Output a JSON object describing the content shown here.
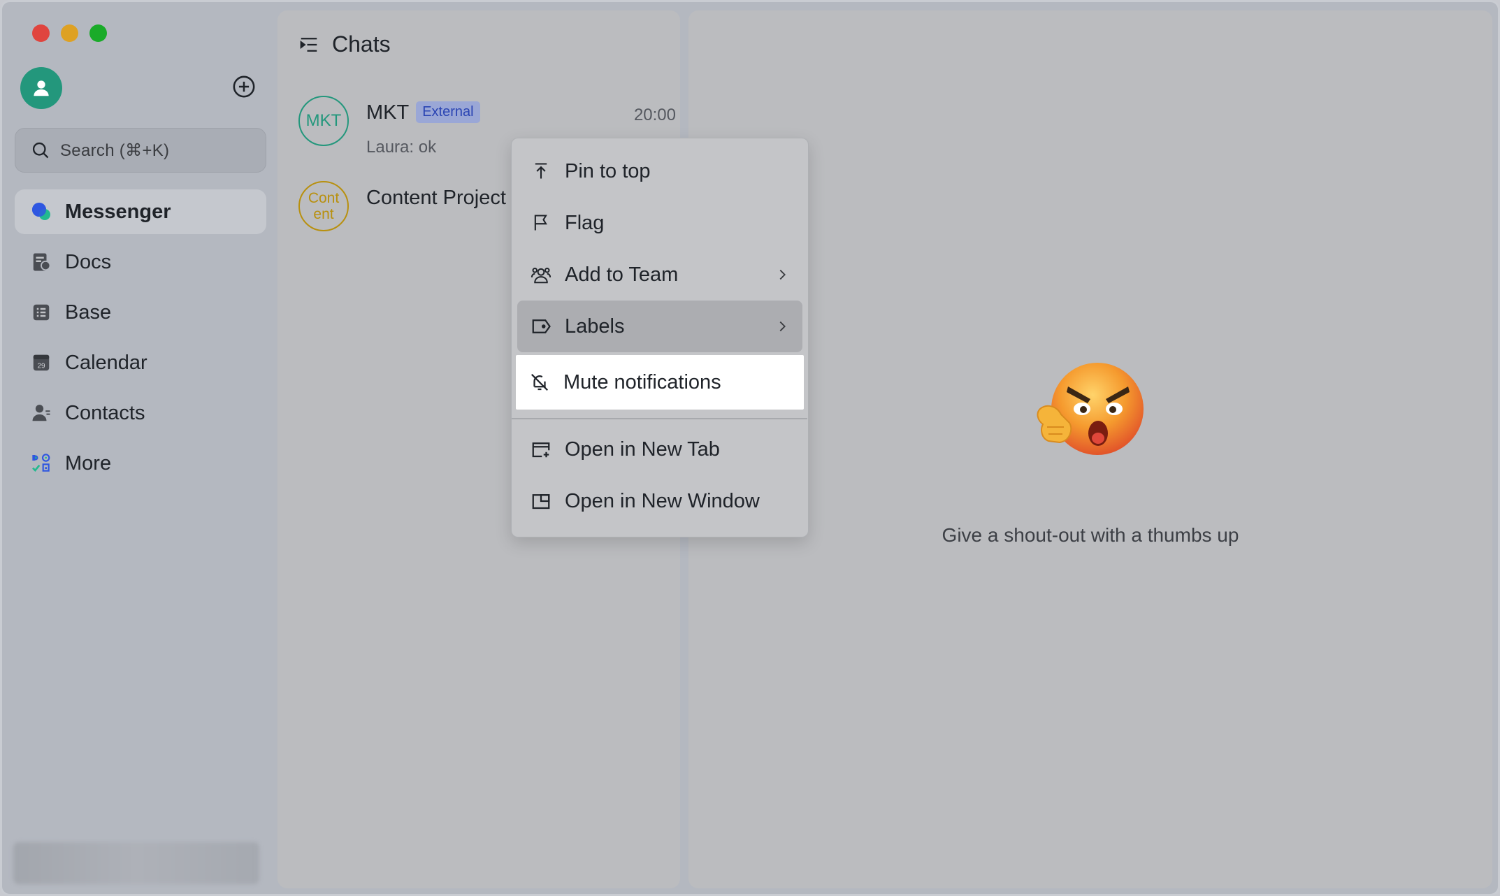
{
  "window": {
    "traffic_lights": [
      "close",
      "minimize",
      "zoom"
    ]
  },
  "sidebar": {
    "search_placeholder": "Search (⌘+K)",
    "items": [
      {
        "label": "Messenger",
        "icon": "messenger-icon",
        "active": true
      },
      {
        "label": "Docs",
        "icon": "docs-icon"
      },
      {
        "label": "Base",
        "icon": "base-icon"
      },
      {
        "label": "Calendar",
        "icon": "calendar-icon",
        "icon_text": "29"
      },
      {
        "label": "Contacts",
        "icon": "contacts-icon"
      },
      {
        "label": "More",
        "icon": "more-apps-icon"
      }
    ]
  },
  "chats": {
    "title": "Chats",
    "list": [
      {
        "avatar_text": "MKT",
        "name": "MKT",
        "badge": "External",
        "time": "20:00",
        "preview": "Laura: ok"
      },
      {
        "avatar_line1": "Cont",
        "avatar_line2": "ent",
        "name": "Content Project"
      }
    ]
  },
  "context_menu": {
    "items": [
      {
        "label": "Pin to top",
        "icon": "pin-top-icon"
      },
      {
        "label": "Flag",
        "icon": "flag-icon"
      },
      {
        "label": "Add to Team",
        "icon": "team-icon",
        "submenu": true
      },
      {
        "label": "Labels",
        "icon": "label-icon",
        "submenu": true,
        "hovered": true
      },
      {
        "label": "Mute notifications",
        "icon": "bell-off-icon",
        "selected": true
      },
      {
        "label": "Open in New Tab",
        "icon": "new-tab-icon"
      },
      {
        "label": "Open in New Window",
        "icon": "new-window-icon"
      }
    ]
  },
  "main": {
    "caption": "Give a shout-out with a thumbs up"
  },
  "colors": {
    "accent_green": "#23977c",
    "badge_bg": "#9aa7d6",
    "badge_text": "#2a44b3",
    "content_avatar": "#b8900f"
  }
}
